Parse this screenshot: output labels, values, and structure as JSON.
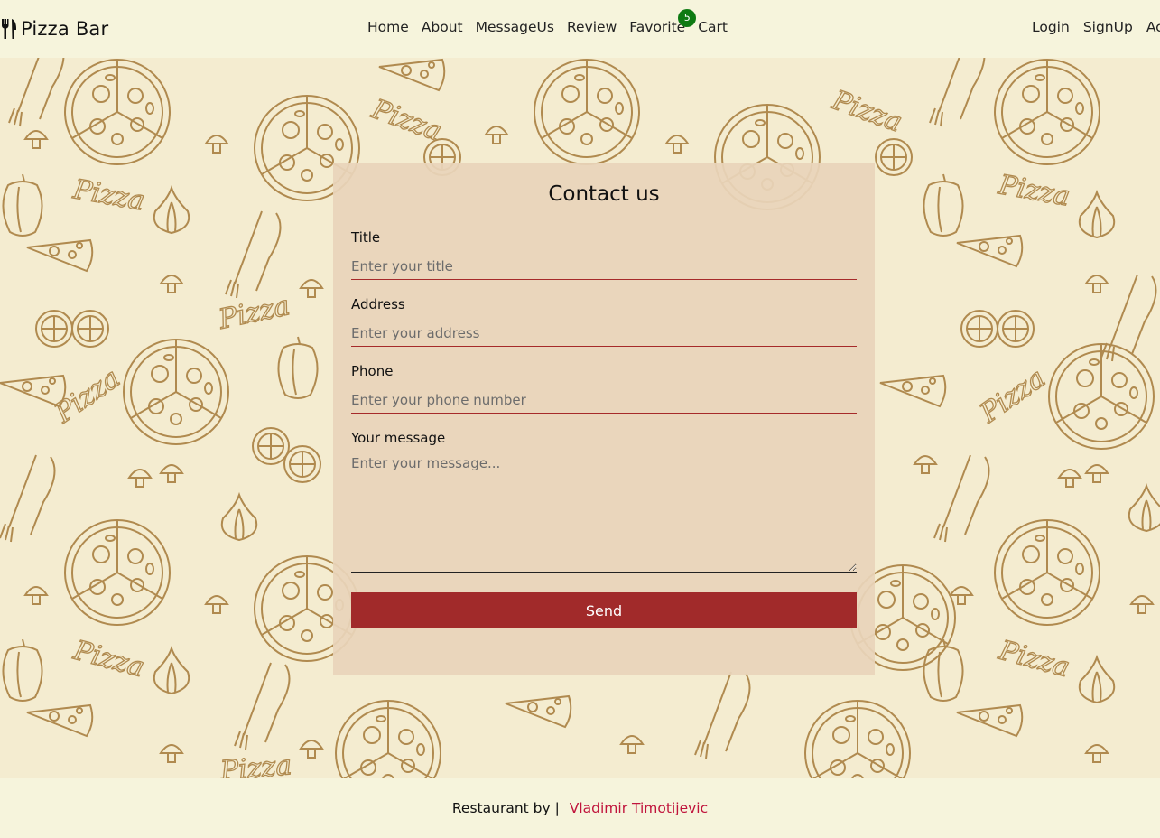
{
  "navbar": {
    "brand": "Pizza Bar",
    "brand_icon": "fork-knife-icon",
    "links": [
      {
        "label": "Home"
      },
      {
        "label": "About"
      },
      {
        "label": "MessageUs"
      },
      {
        "label": "Review"
      },
      {
        "label": "Favorite",
        "badge": "5"
      },
      {
        "label": "Cart"
      }
    ],
    "right_links": [
      {
        "label": "Login"
      },
      {
        "label": "SignUp"
      },
      {
        "label": "Ac"
      }
    ],
    "badge_color": "#0e7a12"
  },
  "background": {
    "pattern_words": [
      "Pizza",
      "Pizza",
      "Pizza",
      "Pizza",
      "Pizza",
      "Pizza"
    ],
    "pattern_icons": [
      "pizza-icon",
      "pizza-slice-icon",
      "mushroom-icon",
      "garlic-icon",
      "pepper-icon",
      "fork-knife-icon",
      "tomato-icon"
    ],
    "stroke_color": "#b08a4f"
  },
  "contact": {
    "title": "Contact us",
    "fields": {
      "title": {
        "label": "Title",
        "placeholder": "Enter your title",
        "value": ""
      },
      "address": {
        "label": "Address",
        "placeholder": "Enter your address",
        "value": ""
      },
      "phone": {
        "label": "Phone",
        "placeholder": "Enter your phone number",
        "value": ""
      },
      "message": {
        "label": "Your message",
        "placeholder": "Enter your message...",
        "value": ""
      }
    },
    "send_label": "Send",
    "accent_color": "#a12a2a"
  },
  "footer": {
    "prefix": "Restaurant by |",
    "author": "Vladimir Timotijevic",
    "author_color": "#c0143c"
  }
}
